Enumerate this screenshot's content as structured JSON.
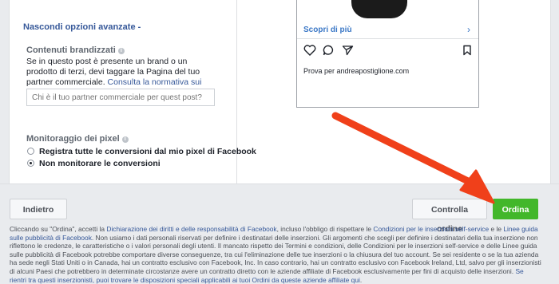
{
  "advanced": {
    "toggle_label": "Nascondi opzioni avanzate -"
  },
  "branded": {
    "title": "Contenuti brandizzati",
    "info": "i",
    "desc": "Se in questo post è presente un brand o un prodotto di terzi, devi taggare la Pagina del tuo partner commerciale.",
    "link": "Consulta la normativa sui contenuti brandizzati",
    "input_placeholder": "Chi è il tuo partner commerciale per quest post?"
  },
  "pixel": {
    "title": "Monitoraggio dei pixel",
    "info": "i",
    "options": [
      {
        "label": "Registra tutte le conversioni dal mio pixel di Facebook",
        "checked": false
      },
      {
        "label": "Non monitorare le conversioni",
        "checked": true
      }
    ]
  },
  "preview": {
    "cta": "Scopri di più",
    "chevron": "›",
    "caption": "Prova per andreapostiglione.com",
    "icons": [
      "heart-icon",
      "comment-icon",
      "share-icon",
      "bookmark-icon"
    ]
  },
  "footer": {
    "back_label": "Indietro",
    "review_label": "Controlla ordine",
    "order_label": "Ordina"
  },
  "legal": {
    "t1": "Cliccando su \"Ordina\", accetti la ",
    "l1": "Dichiarazione dei diritti e delle responsabilità di Facebook",
    "t2": ", incluso l'obbligo di rispettare le ",
    "l2": "Condizioni per le inserzioni self-service",
    "t3": " e le ",
    "l3": "Linee guida sulle pubblicità di Facebook",
    "t4": ". Non usiamo i dati personali riservati per definire i destinatari delle inserzioni. Gli argomenti che scegli per definire i destinatari della tua inserzione non riflettono le credenze, le caratteristiche o i valori personali degli utenti. Il mancato rispetto dei Termini e condizioni, delle Condizioni per le inserzioni self-service e delle Linee guida sulle pubblicità di Facebook potrebbe comportare diverse conseguenze, tra cui l'eliminazione delle tue inserzioni o la chiusura del tuo account. Se sei residente o se la tua azienda ha sede negli Stati Uniti o in Canada, hai un contratto esclusivo con Facebook, Inc. In caso contrario, hai un contratto esclusivo con Facebook Ireland, Ltd, salvo per gli inserzionisti di alcuni Paesi che potrebbero in determinate circostanze avere un contratto diretto con le aziende affiliate di Facebook esclusivamente per fini di acquisto delle inserzioni. ",
    "l4": "Se rientri tra questi inserzionisti, puoi trovare le disposizioni speciali applicabili ai tuoi Ordini da queste aziende affiliate qui",
    "t5": "."
  },
  "colors": {
    "accent": "#365899",
    "order_green": "#42b72a",
    "arrow": "#f0401a"
  }
}
